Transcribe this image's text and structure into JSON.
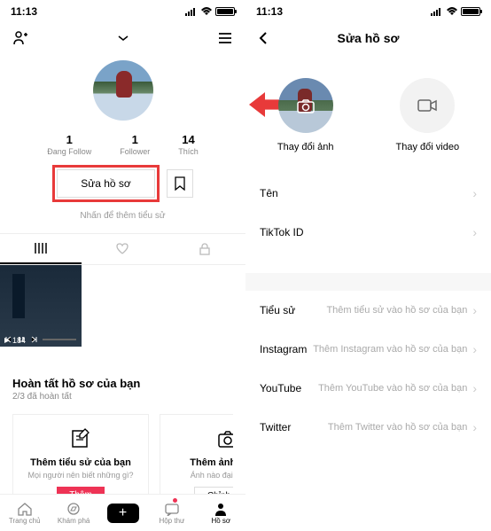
{
  "left": {
    "status": {
      "time": "11:13"
    },
    "avatar": "profile-avatar",
    "stats": [
      {
        "num": "1",
        "label": "Đang Follow"
      },
      {
        "num": "1",
        "label": "Follower"
      },
      {
        "num": "14",
        "label": "Thích"
      }
    ],
    "edit_button": "Sửa hồ sơ",
    "hint": "Nhấn để thêm tiểu sử",
    "video_views": "184",
    "card": {
      "title": "Hoàn tất hồ sơ của bạn",
      "subtitle": "2/3 đã hoàn tất",
      "items": [
        {
          "title": "Thêm tiểu sử của bạn",
          "sub": "Mọi người nên biết những gì?",
          "btn": "Thêm"
        },
        {
          "title": "Thêm ảnh hồ sơ",
          "sub": "Ảnh nào đại diện cho",
          "btn": "Chỉnh sửa"
        }
      ]
    },
    "nav": [
      "Trang chủ",
      "Khám phá",
      "",
      "Hộp thư",
      "Hồ sơ"
    ]
  },
  "right": {
    "status": {
      "time": "11:13"
    },
    "title": "Sửa hồ sơ",
    "media": [
      {
        "label": "Thay đổi ảnh"
      },
      {
        "label": "Thay đổi video"
      }
    ],
    "fields1": [
      {
        "label": "Tên",
        "value": ""
      },
      {
        "label": "TikTok ID",
        "value": ""
      }
    ],
    "fields2": [
      {
        "label": "Tiểu sử",
        "value": "Thêm tiểu sử vào hồ sơ của bạn"
      },
      {
        "label": "Instagram",
        "value": "Thêm Instagram vào hồ sơ của bạn"
      },
      {
        "label": "YouTube",
        "value": "Thêm YouTube vào hồ sơ của bạn"
      },
      {
        "label": "Twitter",
        "value": "Thêm Twitter vào hồ sơ của bạn"
      }
    ]
  }
}
